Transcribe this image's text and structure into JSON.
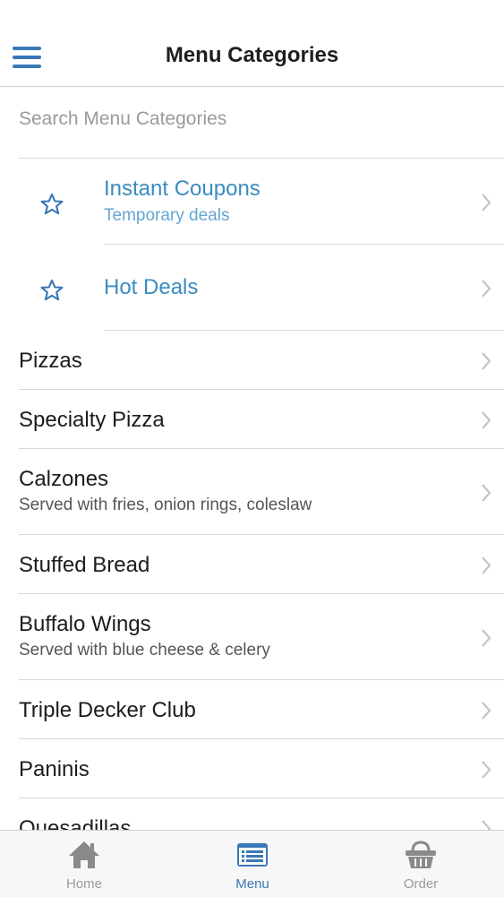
{
  "header": {
    "title": "Menu Categories",
    "menu_icon": "hamburger-menu-icon"
  },
  "search": {
    "placeholder": "Search Menu Categories",
    "value": ""
  },
  "featured": [
    {
      "title": "Instant Coupons",
      "subtitle": "Temporary deals",
      "icon": "star-icon"
    },
    {
      "title": "Hot Deals",
      "subtitle": "",
      "icon": "star-icon"
    }
  ],
  "categories": [
    {
      "title": "Pizzas",
      "subtitle": ""
    },
    {
      "title": "Specialty Pizza",
      "subtitle": ""
    },
    {
      "title": "Calzones",
      "subtitle": "Served with fries, onion rings, coleslaw"
    },
    {
      "title": "Stuffed Bread",
      "subtitle": ""
    },
    {
      "title": "Buffalo Wings",
      "subtitle": "Served with blue cheese & celery"
    },
    {
      "title": "Triple Decker Club",
      "subtitle": ""
    },
    {
      "title": "Paninis",
      "subtitle": ""
    },
    {
      "title": "Quesadillas",
      "subtitle": ""
    }
  ],
  "tabbar": {
    "active": "Menu",
    "tabs": [
      {
        "label": "Home",
        "icon": "home-icon"
      },
      {
        "label": "Menu",
        "icon": "menu-list-icon"
      },
      {
        "label": "Order",
        "icon": "basket-icon"
      }
    ]
  },
  "colors": {
    "accent": "#3a78b8",
    "featured_text": "#3a8cc0",
    "divider": "#d8d8d8",
    "inactive_tab": "#9a9a9a"
  }
}
